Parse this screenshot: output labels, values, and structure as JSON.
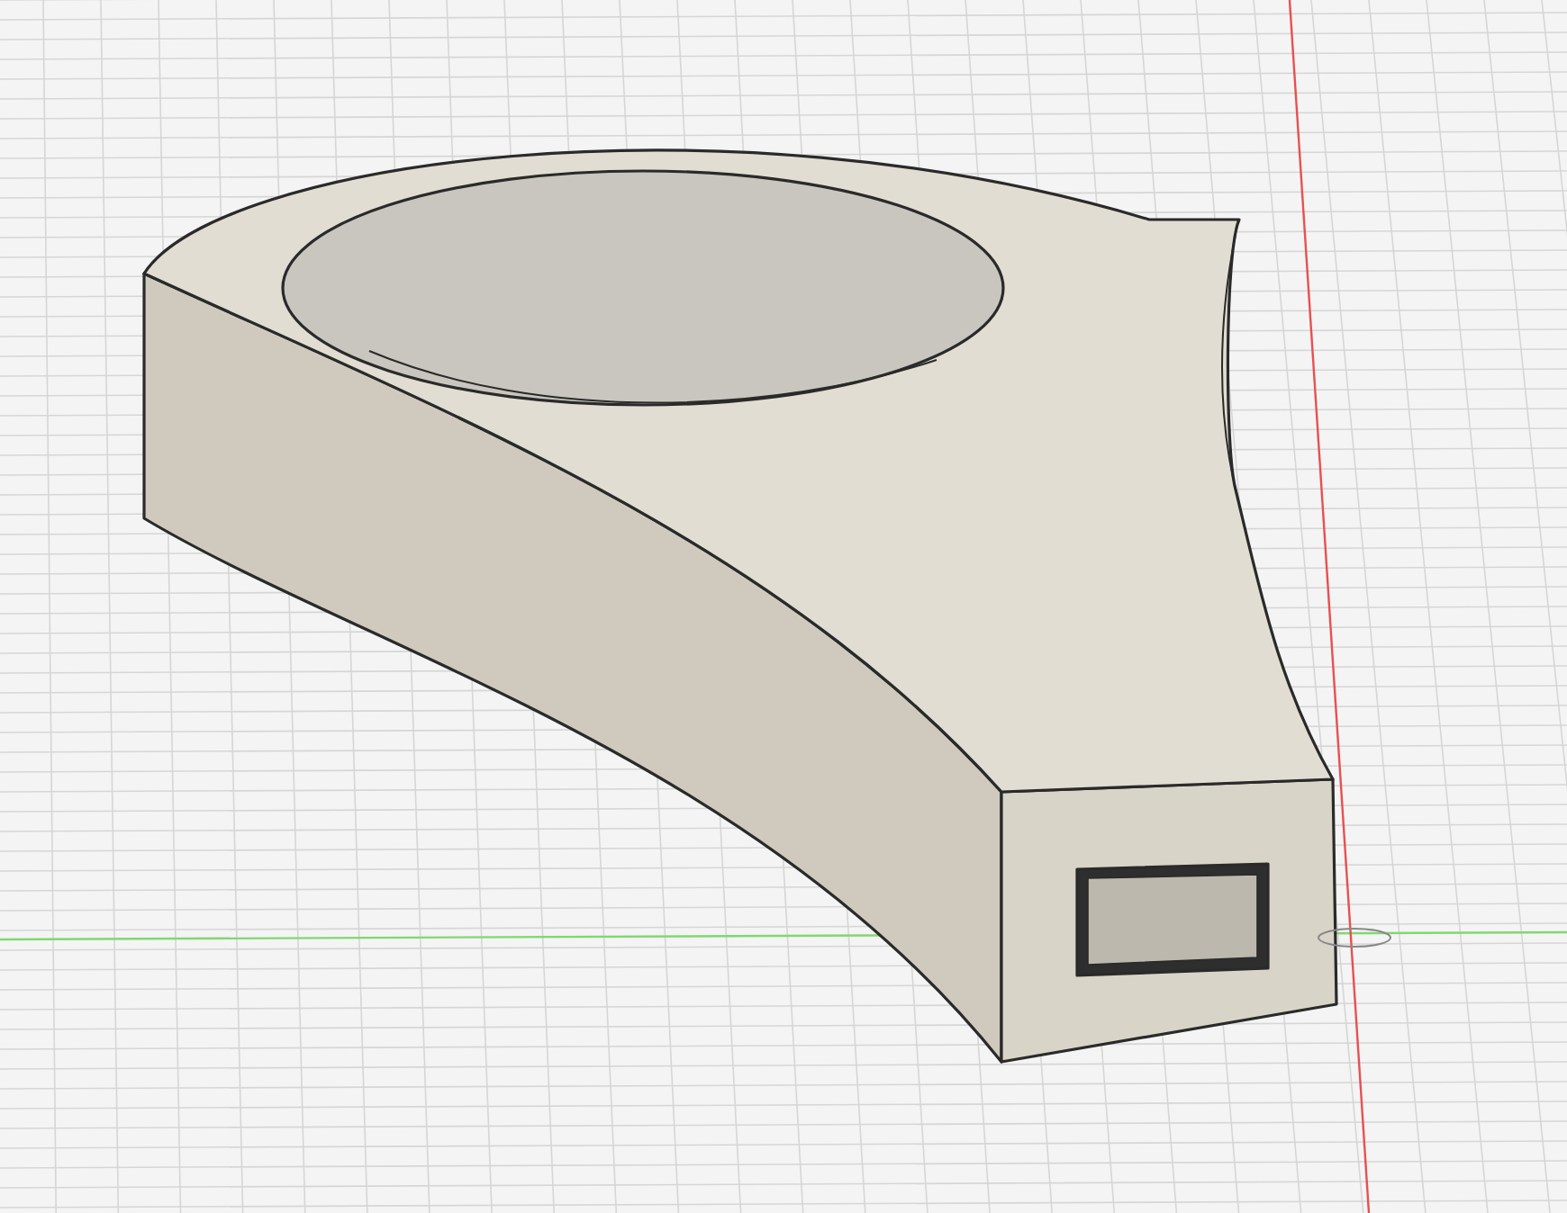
{
  "viewport": {
    "grid": true
  },
  "axes": [
    {
      "kind": "horizontal",
      "color": "#80d870"
    },
    {
      "kind": "vertical",
      "color": "#e85050"
    }
  ]
}
